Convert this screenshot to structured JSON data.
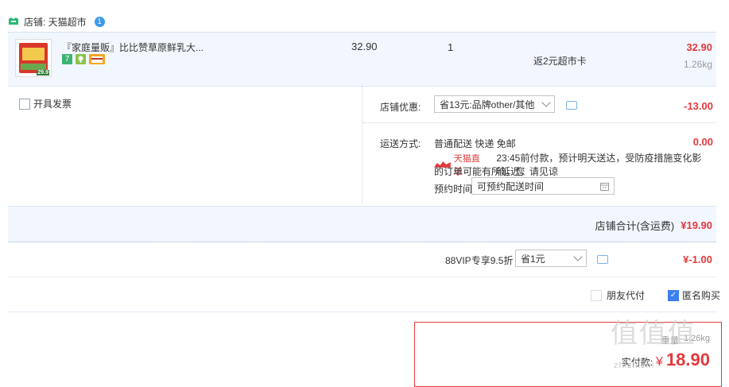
{
  "shop": {
    "label": "店铺: 天猫超市",
    "help_badge": "1"
  },
  "item": {
    "title": "『家庭量贩』比比赞草原鲜乳大...",
    "unit_price": "32.90",
    "quantity": "1",
    "rebate": "返2元超市卡",
    "subtotal": "32.90",
    "weight": "1.26kg",
    "badges": [
      "7",
      "",
      ""
    ],
    "thumb_price": "29.9"
  },
  "invoice": {
    "label": "开具发票"
  },
  "shop_discount": {
    "label": "店铺优惠:",
    "selected": "省13元:品牌other/其他",
    "amount": "-13.00"
  },
  "shipping": {
    "label": "运送方式:",
    "method": "普通配送 快递 免邮",
    "amount": "0.00",
    "tmall_direct": "天猫直送",
    "notice_line1": "23:45前付款，预计明天送达，受防疫措施变化影响，您",
    "notice_line2": "的订单可能有所延迟，请见谅",
    "time_label": "预约时间",
    "time_value": "可预约配送时间"
  },
  "shop_total": {
    "label": "店铺合计(含运费)",
    "amount": "¥19.90"
  },
  "vip": {
    "label": "88VIP专享9.5折",
    "selected": "省1元",
    "amount": "¥-1.00"
  },
  "options": {
    "friend_pay": "朋友代付",
    "anonymous": "匿名购买"
  },
  "pay_box": {
    "weight": "1.26kg",
    "weight_prefix": "重量:",
    "actual_label": "实付款:",
    "currency": "¥",
    "amount": "18.90"
  },
  "watermark": {
    "top": "值值值",
    "bottom": "zhizhizhi"
  },
  "colors": {
    "accent_red": "#e4393c",
    "row_blue": "#f2f7ff",
    "checkbox_blue": "#3a7ff0"
  }
}
